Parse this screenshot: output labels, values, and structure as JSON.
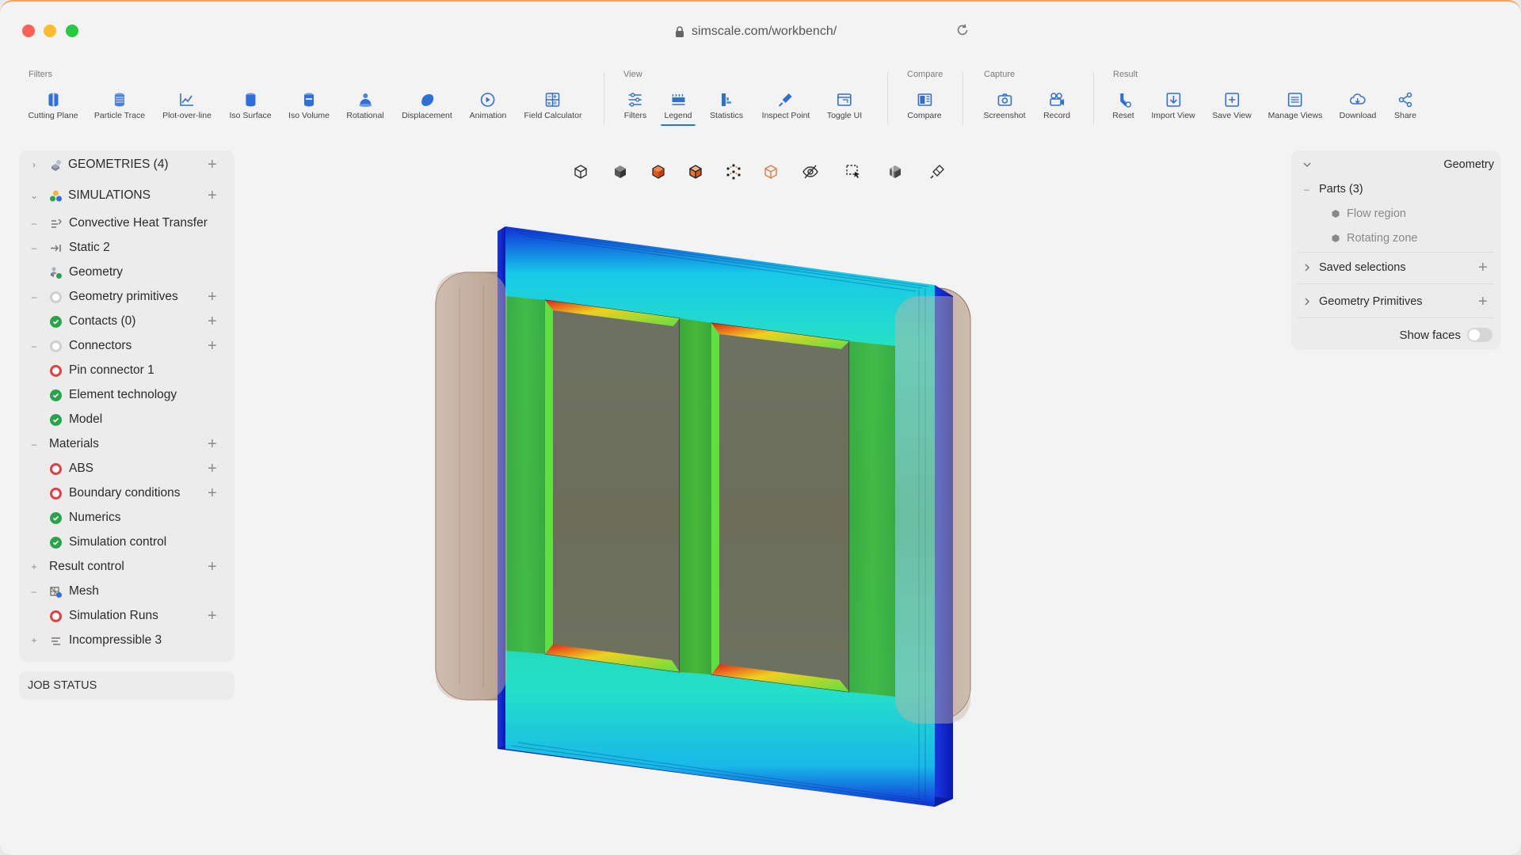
{
  "browser": {
    "url": "simscale.com/workbench/"
  },
  "toolbar": {
    "groups": {
      "filters": "Filters",
      "view": "View",
      "compare": "Compare",
      "capture": "Capture",
      "result": "Result"
    },
    "tools": {
      "cutting_plane": "Cutting Plane",
      "particle_trace": "Particle Trace",
      "plot_over_line": "Plot-over-line",
      "iso_surface": "Iso Surface",
      "iso_volume": "Iso Volume",
      "rotational": "Rotational",
      "displacement": "Displacement",
      "animation": "Animation",
      "field_calculator": "Field Calculator",
      "filters": "Filters",
      "legend": "Legend",
      "statistics": "Statistics",
      "inspect_point": "Inspect Point",
      "toggle_ui": "Toggle UI",
      "compare": "Compare",
      "screenshot": "Screenshot",
      "record": "Record",
      "reset": "Reset",
      "import_view": "Import View",
      "save_view": "Save View",
      "manage_views": "Manage Views",
      "download": "Download",
      "share": "Share"
    },
    "active_tool": "Legend"
  },
  "tree": {
    "geometries": "GEOMETRIES (4)",
    "simulations": "SIMULATIONS",
    "items": {
      "convective": "Convective Heat Transfer",
      "static2": "Static 2",
      "geometry": "Geometry",
      "geo_primitives": "Geometry primitives",
      "contacts": "Contacts (0)",
      "connectors": "Connectors",
      "pin_connector": "Pin connector 1",
      "element_tech": "Element technology",
      "model": "Model",
      "materials": "Materials",
      "abs": "ABS",
      "boundary": "Boundary conditions",
      "numerics": "Numerics",
      "sim_control": "Simulation control",
      "result_control": "Result control",
      "mesh": "Mesh",
      "sim_runs": "Simulation Runs",
      "incompressible": "Incompressible 3"
    }
  },
  "job_status": "JOB STATUS",
  "right_panel": {
    "title": "Geometry",
    "parts": "Parts (3)",
    "flow_region": "Flow region",
    "rotating_zone": "Rotating zone",
    "saved_selections": "Saved selections",
    "geometry_primitives": "Geometry Primitives",
    "show_faces": "Show faces"
  },
  "colors": {
    "accent": "#2d6fdb",
    "ok": "#2aa44a",
    "error": "#e04040",
    "contour_low": "#1a2bd6",
    "contour_high": "#e0201a",
    "coil": "#a08068"
  }
}
